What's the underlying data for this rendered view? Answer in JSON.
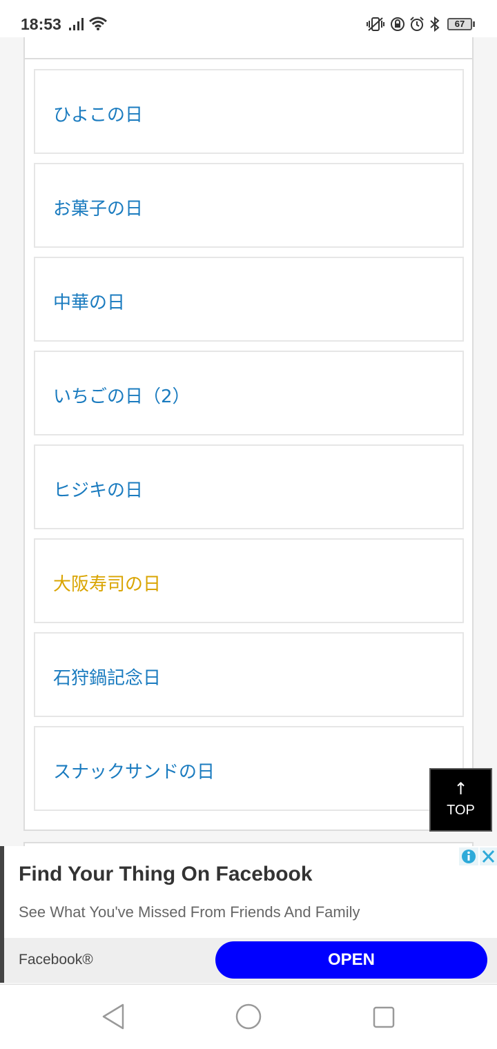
{
  "status_bar": {
    "time": "18:53",
    "battery": "67",
    "icons": [
      "signal-icon",
      "wifi-icon",
      "vibrate-icon",
      "lock-rotation-icon",
      "alarm-icon",
      "bluetooth-icon",
      "battery-icon"
    ]
  },
  "list": {
    "items": [
      {
        "label": "ひよこの日"
      },
      {
        "label": "お菓子の日"
      },
      {
        "label": "中華の日"
      },
      {
        "label": "いちごの日（2）"
      },
      {
        "label": "ヒジキの日"
      },
      {
        "label": "大阪寿司の日"
      },
      {
        "label": "石狩鍋記念日"
      },
      {
        "label": "スナックサンドの日"
      }
    ],
    "link_color": "#1a7bbf",
    "visited_color": "#d9a400"
  },
  "top_button": {
    "arrow": "↑",
    "label": "TOP"
  },
  "ad": {
    "title": "Find Your Thing On Facebook",
    "subtitle": "See What You've Missed From Friends And Family",
    "advertiser": "Facebook®",
    "cta": "OPEN",
    "cta_color": "#0000ff",
    "icons": [
      "ad-info-icon",
      "ad-close-icon"
    ]
  },
  "nav_bar": {
    "icons": [
      "back-icon",
      "home-icon",
      "recents-icon"
    ]
  }
}
